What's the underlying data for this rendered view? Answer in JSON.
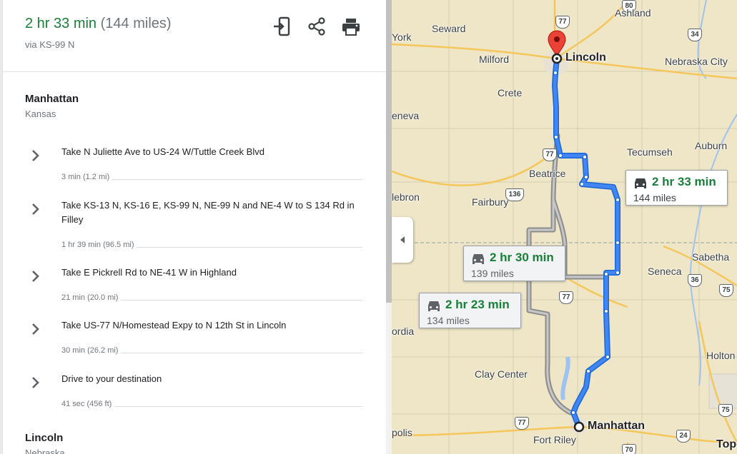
{
  "summary": {
    "duration": "2 hr 33 min",
    "distance": "(144 miles)",
    "via": "via KS-99 N"
  },
  "toolbar": {
    "send_icon": "send-to-phone-icon",
    "share_icon": "share-icon",
    "print_icon": "print-icon"
  },
  "origin": {
    "name": "Manhattan",
    "region": "Kansas"
  },
  "steps": [
    {
      "instruction": "Take N Juliette Ave to US-24 W/Tuttle Creek Blvd",
      "meta": "3 min (1.2 mi)"
    },
    {
      "instruction": "Take KS-13 N, KS-16 E, KS-99 N, NE-99 N and NE-4 W to S 134 Rd in Filley",
      "meta": "1 hr 39 min (96.5 mi)"
    },
    {
      "instruction": "Take E Pickrell Rd to NE-41 W in Highland",
      "meta": "21 min (20.0 mi)"
    },
    {
      "instruction": "Take US-77 N/Homestead Expy to N 12th St in Lincoln",
      "meta": "30 min (26.2 mi)"
    },
    {
      "instruction": "Drive to your destination",
      "meta": "41 sec (456 ft)"
    }
  ],
  "destination": {
    "name": "Lincoln",
    "region": "Nebraska"
  },
  "map": {
    "route_color": "#4285f4",
    "alt_route_color": "#9aa0a6",
    "cities": {
      "lincoln": "Lincoln",
      "manhattan": "Manhattan",
      "seward": "Seward",
      "ashland": "Ashland",
      "york": "York",
      "milford": "Milford",
      "crete": "Crete",
      "nebraska_city": "Nebraska City",
      "geneva": "eneva",
      "tecumseh": "Tecumseh",
      "auburn": "Auburn",
      "beatrice": "Beatrice",
      "hebron": "lebron",
      "fairbury": "Fairbury",
      "sabetha": "Sabetha",
      "seneca": "Seneca",
      "concordia": "ordia",
      "holton": "Holton",
      "clay_center": "Clay Center",
      "fort_riley": "Fort Riley",
      "minneapolis": "polis",
      "topeka": "Tope"
    },
    "shields": [
      "77",
      "80",
      "34",
      "77",
      "136",
      "77",
      "36",
      "75",
      "77",
      "24",
      "75",
      "70"
    ],
    "routes": [
      {
        "time": "2 hr 33 min",
        "distance": "144 miles"
      },
      {
        "time": "2 hr 30 min",
        "distance": "139 miles"
      },
      {
        "time": "2 hr 23 min",
        "distance": "134 miles"
      }
    ]
  }
}
